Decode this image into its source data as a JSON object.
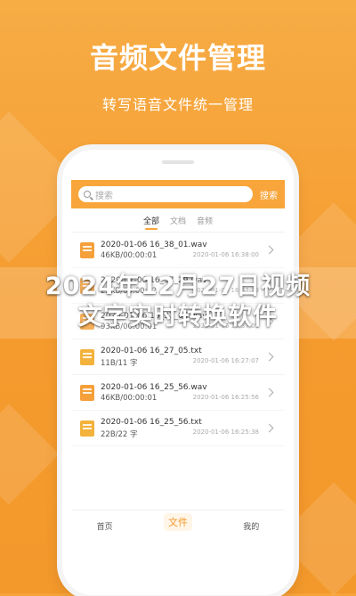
{
  "promo": {
    "title": "音频文件管理",
    "subtitle": "转写语音文件统一管理"
  },
  "search": {
    "placeholder": "搜索",
    "button_label": "搜索"
  },
  "tabs": [
    {
      "label": "全部",
      "active": true
    },
    {
      "label": "文档",
      "active": false
    },
    {
      "label": "音频",
      "active": false
    }
  ],
  "files": [
    {
      "name": "2020-01-06 16_38_01.wav",
      "size": "46KB/00:00:01",
      "date": "2020-01-06 16:38:00",
      "type": "wav"
    },
    {
      "name": "2020-01-06 16_37_29.wav",
      "size": "23KB/00:00:02",
      "date": "2020-01-06 16:37:29",
      "type": "wav"
    },
    {
      "name": "2020-01-06 16_37_05.wav",
      "size": "93KB/00:00:01",
      "date": "2020-01-06 16:37:05",
      "type": "wav"
    },
    {
      "name": "2020-01-06 16_27_05.txt",
      "size": "11B/11 字",
      "date": "2020-01-06 16:27:07",
      "type": "txt"
    },
    {
      "name": "2020-01-06 16_25_56.wav",
      "size": "46KB/00:00:01",
      "date": "2020-01-06 16:25:56",
      "type": "wav"
    },
    {
      "name": "2020-01-06 16_25_56.txt",
      "size": "22B/22 字",
      "date": "2020-01-06 16:25:38",
      "type": "txt"
    }
  ],
  "bottom_nav": [
    {
      "label": "首页",
      "active": false
    },
    {
      "label": "文件",
      "active": true
    },
    {
      "label": "我的",
      "active": false
    }
  ],
  "overlay": {
    "line1": "2024年12月27日视频",
    "line2": "文字实时转换软件"
  },
  "colors": {
    "accent": "#f8a63b",
    "background": "#f6a33a"
  }
}
